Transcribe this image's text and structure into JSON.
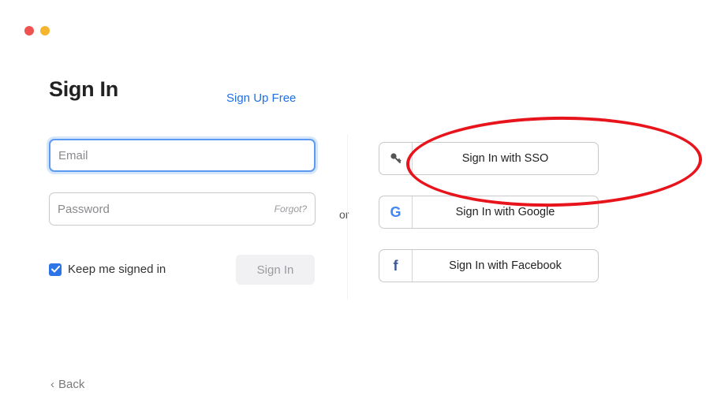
{
  "window": {
    "controls": [
      "close-dot",
      "minimize-dot"
    ]
  },
  "header": {
    "title": "Sign In",
    "signup_link": "Sign Up Free"
  },
  "form": {
    "email_placeholder": "Email",
    "password_placeholder": "Password",
    "forgot_label": "Forgot?",
    "keep_signed_in_label": "Keep me signed in",
    "keep_signed_in_checked": true,
    "sign_in_label": "Sign In"
  },
  "separator": {
    "or_label": "or"
  },
  "social": [
    {
      "label": "Sign In with SSO",
      "icon": "key-icon"
    },
    {
      "label": "Sign In with Google",
      "icon": "google-icon"
    },
    {
      "label": "Sign In with Facebook",
      "icon": "facebook-icon"
    }
  ],
  "footer": {
    "back_label": "Back"
  },
  "colors": {
    "accent": "#1f6fe6",
    "annotation": "#e8141c",
    "google_g": "#4285f4",
    "facebook_f": "#3b5998"
  }
}
